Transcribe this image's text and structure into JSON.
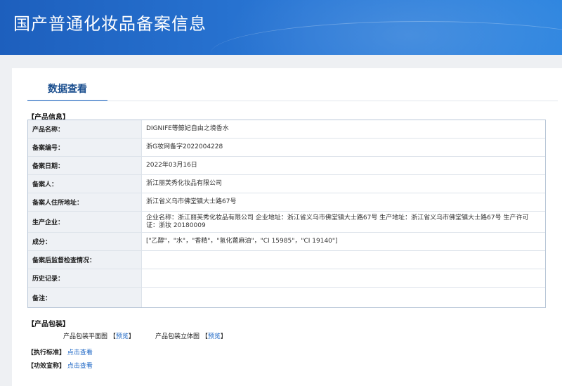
{
  "header": {
    "title": "国产普通化妆品备案信息"
  },
  "tab": {
    "label": "数据查看"
  },
  "sections": {
    "product_info": "【产品信息】",
    "product_package": "【产品包装】",
    "standard": "【执行标准】",
    "efficacy": "【功效宣称】"
  },
  "rows": [
    {
      "label": "产品名称：",
      "value": "DIGNIFE等鲸妃自由之境香水"
    },
    {
      "label": "备案编号：",
      "value": "浙G妆网备字2022004228"
    },
    {
      "label": "备案日期：",
      "value": "2022年03月16日"
    },
    {
      "label": "备案人：",
      "value": "浙江丽芙秀化妆品有限公司"
    },
    {
      "label": "备案人住所地址：",
      "value": "浙江省义乌市佛堂镇大士路67号"
    },
    {
      "label": "生产企业：",
      "value": "企业名称：浙江丽芙秀化妆品有限公司 企业地址：浙江省义乌市佛堂镇大士路67号 生产地址：浙江省义乌市佛堂镇大士路67号 生产许可证：浙妆 20180009"
    },
    {
      "label": "成分：",
      "value": "[\"乙醇\"，\"水\"，\"香精\"，\"氢化蓖麻油\"，\"CI 15985\"，\"CI 19140\"]"
    },
    {
      "label": "备案后监督检查情况：",
      "value": ""
    },
    {
      "label": "历史记录：",
      "value": ""
    },
    {
      "label": "备注：",
      "value": ""
    }
  ],
  "package": {
    "flat_label": "产品包装平面图",
    "solid_label": "产品包装立体图",
    "open_bracket": "【",
    "close_bracket": "】",
    "preview": "预览"
  },
  "links": {
    "view": "点击查看"
  },
  "colors": {
    "header": "#2a78d6",
    "link": "#1b65c4",
    "tab_underline": "#1b65c4"
  }
}
